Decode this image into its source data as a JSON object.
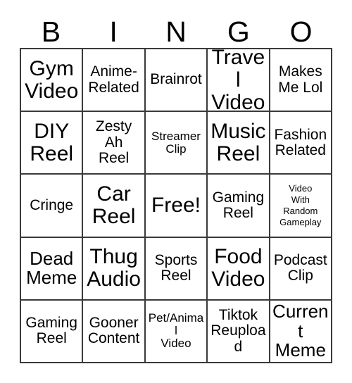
{
  "card": {
    "title_letters": [
      "B",
      "I",
      "N",
      "G",
      "O"
    ],
    "columns": 5,
    "rows": 5,
    "free_space_label": "Free!",
    "free_space_position": "center",
    "border_color": "#3a3a3a",
    "background_color": "#ffffff",
    "text_color": "#000000"
  },
  "cells": [
    {
      "text": "Gym\nVideo",
      "size": "fs-xl"
    },
    {
      "text": "Anime-\nRelated",
      "size": "fs-md"
    },
    {
      "text": "Brainrot",
      "size": "fs-md"
    },
    {
      "text": "Travel\nVideo",
      "size": "fs-xl"
    },
    {
      "text": "Makes\nMe Lol",
      "size": "fs-md"
    },
    {
      "text": "DIY\nReel",
      "size": "fs-xl"
    },
    {
      "text": "Zesty\nAh\nReel",
      "size": "fs-md"
    },
    {
      "text": "Streamer\nClip",
      "size": "fs-sm"
    },
    {
      "text": "Music\nReel",
      "size": "fs-xl"
    },
    {
      "text": "Fashion\nRelated",
      "size": "fs-md"
    },
    {
      "text": "Cringe",
      "size": "fs-md"
    },
    {
      "text": "Car\nReel",
      "size": "fs-xl"
    },
    {
      "text": "Free!",
      "size": "fs-xl"
    },
    {
      "text": "Gaming\nReel",
      "size": "fs-md"
    },
    {
      "text": "Video\nWith\nRandom\nGameplay",
      "size": "fs-xs"
    },
    {
      "text": "Dead\nMeme",
      "size": "fs-lg"
    },
    {
      "text": "Thug\nAudio",
      "size": "fs-xl"
    },
    {
      "text": "Sports\nReel",
      "size": "fs-md"
    },
    {
      "text": "Food\nVideo",
      "size": "fs-xl"
    },
    {
      "text": "Podcast\nClip",
      "size": "fs-md"
    },
    {
      "text": "Gaming\nReel",
      "size": "fs-md"
    },
    {
      "text": "Gooner\nContent",
      "size": "fs-md"
    },
    {
      "text": "Pet/Animal\nVideo",
      "size": "fs-sm"
    },
    {
      "text": "Tiktok\nReupload",
      "size": "fs-md"
    },
    {
      "text": "Current\nMeme",
      "size": "fs-lg"
    }
  ]
}
